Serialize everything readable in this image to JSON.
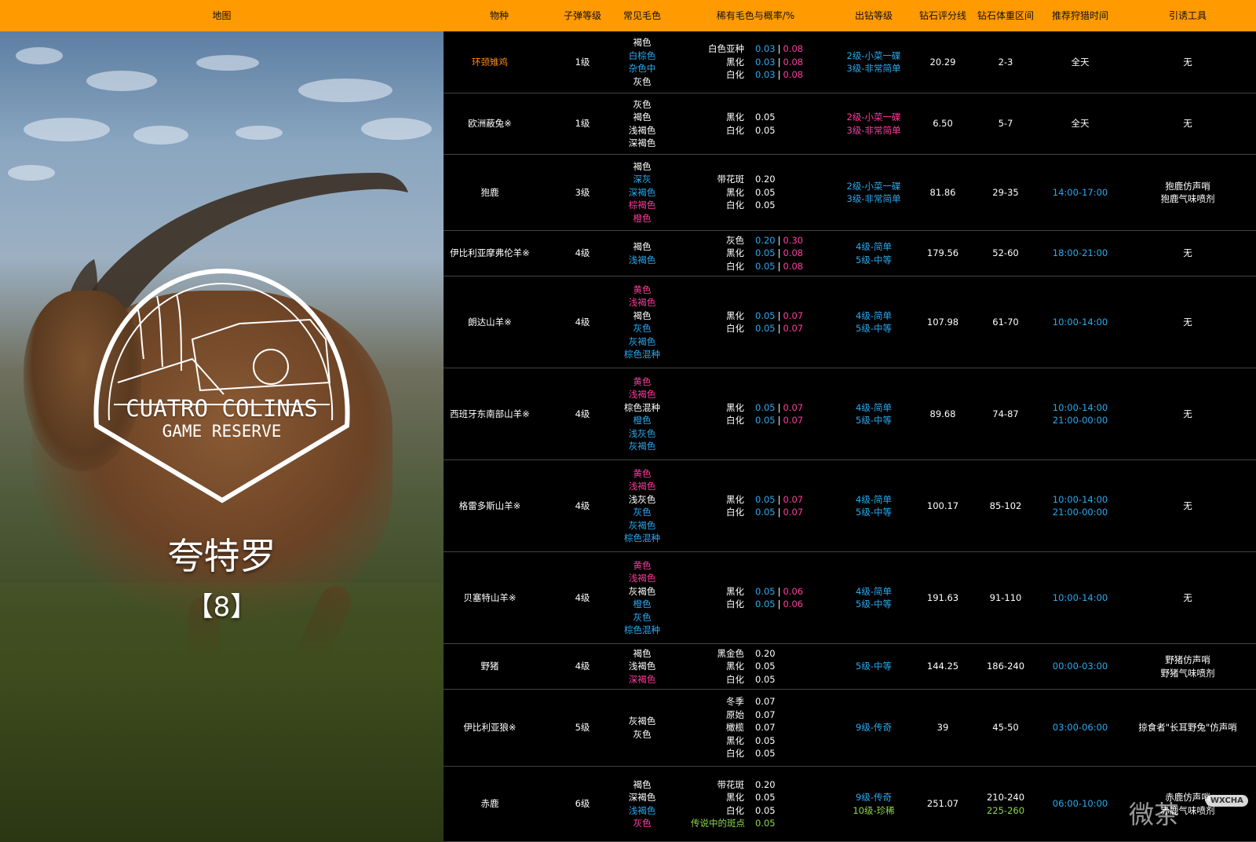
{
  "colors": {
    "header_bg": "#ff9a00",
    "white": "#ffffff",
    "blue": "#29aaf0",
    "pink": "#ff3c9e",
    "orange": "#ff8c1a",
    "green": "#8fd84a"
  },
  "header": {
    "map": "地图",
    "species": "物种",
    "ammo": "子弹等级",
    "common_fur": "常见毛色",
    "rare_fur": "稀有毛色与概率/%",
    "diamond_level": "出钻等级",
    "diamond_score": "钻石评分线",
    "diamond_weight": "钻石体重区间",
    "hunt_time": "推荐狩猎时间",
    "lure": "引诱工具"
  },
  "map_panel": {
    "logo_line1": "CUATRO COLINAS",
    "logo_line2": "GAME RESERVE",
    "map_name": "夸特罗",
    "map_count": "【8】"
  },
  "rows": [
    {
      "species": {
        "t": "环颈雉鸡",
        "c": "orange"
      },
      "ammo": "1级",
      "fur": [
        {
          "t": "褐色",
          "c": "white"
        },
        {
          "t": "白棕色",
          "c": "blue"
        },
        {
          "t": "杂色中",
          "c": "blue"
        },
        {
          "t": "灰色",
          "c": "white"
        }
      ],
      "rare": [
        {
          "name": "白色亚种",
          "v": [
            {
              "t": "0.03",
              "c": "blue"
            },
            {
              "t": "0.08",
              "c": "pink"
            }
          ]
        },
        {
          "name": "黑化",
          "v": [
            {
              "t": "0.03",
              "c": "blue"
            },
            {
              "t": "0.08",
              "c": "pink"
            }
          ]
        },
        {
          "name": "白化",
          "v": [
            {
              "t": "0.03",
              "c": "blue"
            },
            {
              "t": "0.08",
              "c": "pink"
            }
          ]
        }
      ],
      "level": [
        {
          "t": "2级-小菜一碟",
          "c": "blue"
        },
        {
          "t": "3级-非常简单",
          "c": "blue"
        }
      ],
      "score": "20.29",
      "weight": [
        {
          "t": "2-3",
          "c": "white"
        }
      ],
      "time": [
        {
          "t": "全天",
          "c": "white"
        }
      ],
      "lure": [
        "无"
      ]
    },
    {
      "species": {
        "t": "欧洲蔽兔※",
        "c": "white"
      },
      "ammo": "1级",
      "fur": [
        {
          "t": "灰色",
          "c": "white"
        },
        {
          "t": "褐色",
          "c": "white"
        },
        {
          "t": "浅褐色",
          "c": "white"
        },
        {
          "t": "深褐色",
          "c": "white"
        }
      ],
      "rare": [
        {
          "name": "黑化",
          "v": [
            {
              "t": "0.05",
              "c": "white"
            }
          ]
        },
        {
          "name": "白化",
          "v": [
            {
              "t": "0.05",
              "c": "white"
            }
          ]
        }
      ],
      "level": [
        {
          "t": "2级-小菜一碟",
          "c": "pink"
        },
        {
          "t": "3级-非常简单",
          "c": "pink"
        }
      ],
      "score": "6.50",
      "weight": [
        {
          "t": "5-7",
          "c": "white"
        }
      ],
      "time": [
        {
          "t": "全天",
          "c": "white"
        }
      ],
      "lure": [
        "无"
      ]
    },
    {
      "species": {
        "t": "狍鹿",
        "c": "white"
      },
      "ammo": "3级",
      "fur": [
        {
          "t": "褐色",
          "c": "white"
        },
        {
          "t": "深灰",
          "c": "blue"
        },
        {
          "t": "深褐色",
          "c": "blue"
        },
        {
          "t": "棕褐色",
          "c": "pink"
        },
        {
          "t": "橙色",
          "c": "pink"
        }
      ],
      "rare": [
        {
          "name": "带花斑",
          "v": [
            {
              "t": "0.20",
              "c": "white"
            }
          ]
        },
        {
          "name": "黑化",
          "v": [
            {
              "t": "0.05",
              "c": "white"
            }
          ]
        },
        {
          "name": "白化",
          "v": [
            {
              "t": "0.05",
              "c": "white"
            }
          ]
        }
      ],
      "level": [
        {
          "t": "2级-小菜一碟",
          "c": "blue"
        },
        {
          "t": "3级-非常简单",
          "c": "blue"
        }
      ],
      "score": "81.86",
      "weight": [
        {
          "t": "29-35",
          "c": "white"
        }
      ],
      "time": [
        {
          "t": "14:00-17:00",
          "c": "blue"
        }
      ],
      "lure": [
        "狍鹿仿声哨",
        "狍鹿气味喷剂"
      ]
    },
    {
      "species": {
        "t": "伊比利亚摩弗伦羊※",
        "c": "white"
      },
      "ammo": "4级",
      "fur": [
        {
          "t": "褐色",
          "c": "white"
        },
        {
          "t": "浅褐色",
          "c": "blue"
        }
      ],
      "rare": [
        {
          "name": "灰色",
          "v": [
            {
              "t": "0.20",
              "c": "blue"
            },
            {
              "t": "0.30",
              "c": "pink"
            }
          ]
        },
        {
          "name": "黑化",
          "v": [
            {
              "t": "0.05",
              "c": "blue"
            },
            {
              "t": "0.08",
              "c": "pink"
            }
          ]
        },
        {
          "name": "白化",
          "v": [
            {
              "t": "0.05",
              "c": "blue"
            },
            {
              "t": "0.08",
              "c": "pink"
            }
          ]
        }
      ],
      "level": [
        {
          "t": "4级-简单",
          "c": "blue"
        },
        {
          "t": "5级-中等",
          "c": "blue"
        }
      ],
      "score": "179.56",
      "weight": [
        {
          "t": "52-60",
          "c": "white"
        }
      ],
      "time": [
        {
          "t": "18:00-21:00",
          "c": "blue"
        }
      ],
      "lure": [
        "无"
      ]
    },
    {
      "species": {
        "t": "朗达山羊※",
        "c": "white"
      },
      "ammo": "4级",
      "fur": [
        {
          "t": "黄色",
          "c": "pink"
        },
        {
          "t": "浅褐色",
          "c": "pink"
        },
        {
          "t": "褐色",
          "c": "white"
        },
        {
          "t": "灰色",
          "c": "blue"
        },
        {
          "t": "灰褐色",
          "c": "blue"
        },
        {
          "t": "棕色混种",
          "c": "blue"
        }
      ],
      "rare": [
        {
          "name": "黑化",
          "v": [
            {
              "t": "0.05",
              "c": "blue"
            },
            {
              "t": "0.07",
              "c": "pink"
            }
          ]
        },
        {
          "name": "白化",
          "v": [
            {
              "t": "0.05",
              "c": "blue"
            },
            {
              "t": "0.07",
              "c": "pink"
            }
          ]
        }
      ],
      "level": [
        {
          "t": "4级-简单",
          "c": "blue"
        },
        {
          "t": "5级-中等",
          "c": "blue"
        }
      ],
      "score": "107.98",
      "weight": [
        {
          "t": "61-70",
          "c": "white"
        }
      ],
      "time": [
        {
          "t": "10:00-14:00",
          "c": "blue"
        }
      ],
      "lure": [
        "无"
      ]
    },
    {
      "species": {
        "t": "西班牙东南部山羊※",
        "c": "white"
      },
      "ammo": "4级",
      "fur": [
        {
          "t": "黄色",
          "c": "pink"
        },
        {
          "t": "浅褐色",
          "c": "pink"
        },
        {
          "t": "棕色混种",
          "c": "white"
        },
        {
          "t": "橙色",
          "c": "blue"
        },
        {
          "t": "浅灰色",
          "c": "blue"
        },
        {
          "t": "灰褐色",
          "c": "blue"
        }
      ],
      "rare": [
        {
          "name": "黑化",
          "v": [
            {
              "t": "0.05",
              "c": "blue"
            },
            {
              "t": "0.07",
              "c": "pink"
            }
          ]
        },
        {
          "name": "白化",
          "v": [
            {
              "t": "0.05",
              "c": "blue"
            },
            {
              "t": "0.07",
              "c": "pink"
            }
          ]
        }
      ],
      "level": [
        {
          "t": "4级-简单",
          "c": "blue"
        },
        {
          "t": "5级-中等",
          "c": "blue"
        }
      ],
      "score": "89.68",
      "weight": [
        {
          "t": "74-87",
          "c": "white"
        }
      ],
      "time": [
        {
          "t": "10:00-14:00",
          "c": "blue"
        },
        {
          "t": "21:00-00:00",
          "c": "blue"
        }
      ],
      "lure": [
        "无"
      ]
    },
    {
      "species": {
        "t": "格雷多斯山羊※",
        "c": "white"
      },
      "ammo": "4级",
      "fur": [
        {
          "t": "黄色",
          "c": "pink"
        },
        {
          "t": "浅褐色",
          "c": "pink"
        },
        {
          "t": "浅灰色",
          "c": "white"
        },
        {
          "t": "灰色",
          "c": "blue"
        },
        {
          "t": "灰褐色",
          "c": "blue"
        },
        {
          "t": "棕色混种",
          "c": "blue"
        }
      ],
      "rare": [
        {
          "name": "黑化",
          "v": [
            {
              "t": "0.05",
              "c": "blue"
            },
            {
              "t": "0.07",
              "c": "pink"
            }
          ]
        },
        {
          "name": "白化",
          "v": [
            {
              "t": "0.05",
              "c": "blue"
            },
            {
              "t": "0.07",
              "c": "pink"
            }
          ]
        }
      ],
      "level": [
        {
          "t": "4级-简单",
          "c": "blue"
        },
        {
          "t": "5级-中等",
          "c": "blue"
        }
      ],
      "score": "100.17",
      "weight": [
        {
          "t": "85-102",
          "c": "white"
        }
      ],
      "time": [
        {
          "t": "10:00-14:00",
          "c": "blue"
        },
        {
          "t": "21:00-00:00",
          "c": "blue"
        }
      ],
      "lure": [
        "无"
      ]
    },
    {
      "species": {
        "t": "贝塞特山羊※",
        "c": "white"
      },
      "ammo": "4级",
      "fur": [
        {
          "t": "黄色",
          "c": "pink"
        },
        {
          "t": "浅褐色",
          "c": "pink"
        },
        {
          "t": "灰褐色",
          "c": "white"
        },
        {
          "t": "橙色",
          "c": "blue"
        },
        {
          "t": "灰色",
          "c": "blue"
        },
        {
          "t": "棕色混种",
          "c": "blue"
        }
      ],
      "rare": [
        {
          "name": "黑化",
          "v": [
            {
              "t": "0.05",
              "c": "blue"
            },
            {
              "t": "0.06",
              "c": "pink"
            }
          ]
        },
        {
          "name": "白化",
          "v": [
            {
              "t": "0.05",
              "c": "blue"
            },
            {
              "t": "0.06",
              "c": "pink"
            }
          ]
        }
      ],
      "level": [
        {
          "t": "4级-简单",
          "c": "blue"
        },
        {
          "t": "5级-中等",
          "c": "blue"
        }
      ],
      "score": "191.63",
      "weight": [
        {
          "t": "91-110",
          "c": "white"
        }
      ],
      "time": [
        {
          "t": "10:00-14:00",
          "c": "blue"
        }
      ],
      "lure": [
        "无"
      ]
    },
    {
      "species": {
        "t": "野猪",
        "c": "white"
      },
      "ammo": "4级",
      "fur": [
        {
          "t": "褐色",
          "c": "white"
        },
        {
          "t": "浅褐色",
          "c": "white"
        },
        {
          "t": "深褐色",
          "c": "pink"
        }
      ],
      "rare": [
        {
          "name": "黑金色",
          "v": [
            {
              "t": "0.20",
              "c": "white"
            }
          ]
        },
        {
          "name": "黑化",
          "v": [
            {
              "t": "0.05",
              "c": "white"
            }
          ]
        },
        {
          "name": "白化",
          "v": [
            {
              "t": "0.05",
              "c": "white"
            }
          ]
        }
      ],
      "level": [
        {
          "t": "5级-中等",
          "c": "blue"
        }
      ],
      "score": "144.25",
      "weight": [
        {
          "t": "186-240",
          "c": "white"
        }
      ],
      "time": [
        {
          "t": "00:00-03:00",
          "c": "blue"
        }
      ],
      "lure": [
        "野猪仿声哨",
        "野猪气味喷剂"
      ]
    },
    {
      "species": {
        "t": "伊比利亚狼※",
        "c": "white"
      },
      "ammo": "5级",
      "fur": [
        {
          "t": "灰褐色",
          "c": "white"
        },
        {
          "t": "灰色",
          "c": "white"
        }
      ],
      "rare": [
        {
          "name": "冬季",
          "v": [
            {
              "t": "0.07",
              "c": "white"
            }
          ]
        },
        {
          "name": "原始",
          "v": [
            {
              "t": "0.07",
              "c": "white"
            }
          ]
        },
        {
          "name": "橄榄",
          "v": [
            {
              "t": "0.07",
              "c": "white"
            }
          ]
        },
        {
          "name": "黑化",
          "v": [
            {
              "t": "0.05",
              "c": "white"
            }
          ]
        },
        {
          "name": "白化",
          "v": [
            {
              "t": "0.05",
              "c": "white"
            }
          ]
        }
      ],
      "level": [
        {
          "t": "9级-传奇",
          "c": "blue"
        }
      ],
      "score": "39",
      "weight": [
        {
          "t": "45-50",
          "c": "white"
        }
      ],
      "time": [
        {
          "t": "03:00-06:00",
          "c": "blue"
        }
      ],
      "lure": [
        "掠食者\"长耳野兔\"仿声哨"
      ]
    },
    {
      "species": {
        "t": "赤鹿",
        "c": "white"
      },
      "ammo": "6级",
      "fur": [
        {
          "t": "褐色",
          "c": "white"
        },
        {
          "t": "深褐色",
          "c": "white"
        },
        {
          "t": "浅褐色",
          "c": "blue"
        },
        {
          "t": "灰色",
          "c": "pink"
        }
      ],
      "rare": [
        {
          "name": "带花斑",
          "v": [
            {
              "t": "0.20",
              "c": "white"
            }
          ]
        },
        {
          "name": "黑化",
          "v": [
            {
              "t": "0.05",
              "c": "white"
            }
          ]
        },
        {
          "name": "白化",
          "v": [
            {
              "t": "0.05",
              "c": "white"
            }
          ]
        },
        {
          "name": "传说中的斑点",
          "v": [
            {
              "t": "0.05",
              "c": "green"
            }
          ],
          "nc": "green"
        }
      ],
      "level": [
        {
          "t": "9级-传奇",
          "c": "blue"
        },
        {
          "t": "10级-珍稀",
          "c": "green"
        }
      ],
      "score": "251.07",
      "weight": [
        {
          "t": "210-240",
          "c": "white"
        },
        {
          "t": "225-260",
          "c": "green"
        }
      ],
      "time": [
        {
          "t": "06:00-10:00",
          "c": "blue"
        }
      ],
      "lure": [
        "赤鹿仿声哨",
        "赤鹿气味喷剂"
      ]
    }
  ],
  "watermark": {
    "main": "微茶",
    "badge": "WXCHA"
  }
}
